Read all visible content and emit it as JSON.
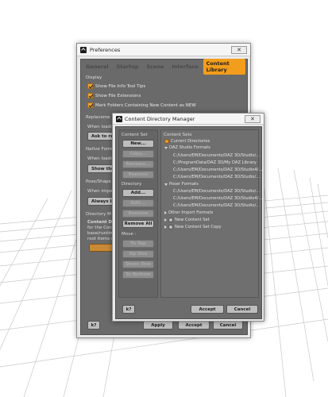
{
  "preferences": {
    "title": "Preferences",
    "close_label": "✕",
    "tabs": [
      "General",
      "Startup",
      "Scene",
      "Interface",
      "Content Library"
    ],
    "active_tab": "Content Library",
    "display_section": "Display",
    "checkboxes": [
      "Show File Info Tool Tips",
      "Show File Extensions",
      "Mark Folders Containing New Content as NEW"
    ],
    "replacement_section": "Replaceme",
    "when_loading_1": "When loadin",
    "ask_button": "Ask to re",
    "native_section": "Native Form",
    "when_loading_2": "When loadin",
    "show_button": "Show the",
    "pose_section": "Pose/Shape",
    "when_importing": "When impor",
    "always_button": "Always lo",
    "directory_section": "Directory M",
    "directory_text": [
      "Content Di",
      "for the Con",
      "base/runtim",
      "root items o"
    ],
    "help_button": "k?",
    "apply_button": "Apply",
    "accept_button": "Accept",
    "cancel_button": "Cancel"
  },
  "cdm": {
    "title": "Content Directory Manager",
    "close_label": "✕",
    "content_set_label": "Content Set",
    "new_button": "New...",
    "copy_button": "Copy...",
    "rename_button": "Rename...",
    "remove_button": "Remove",
    "directory_label": "Directory",
    "add_button": "Add...",
    "edit_button": "Edit...",
    "remove2_button": "Remove",
    "remove_all_button": "Remove All",
    "move_label": "Move :",
    "to_top_button": "To Top",
    "up_one_button": "Up One",
    "down_one_button": "Down One",
    "to_bottom_button": "To Bottom",
    "content_sets_label": "Content Sets",
    "tree": [
      "Current Directories",
      "DAZ Studio Formats",
      "C:/Users/EM/Documents/DAZ 3D/Studio/...",
      "C:/ProgramData/DAZ 3D/My DAZ Library",
      "C:/Users/EM/Documents/DAZ 3D/Studio4/...",
      "C:/Users/EM/Documents/DAZ 3D/Studio/...",
      "Poser Formats",
      "C:/Users/EM/Documents/DAZ 3D/Studio/...",
      "C:/Users/EM/Documents/DAZ 3D/Studio4/...",
      "C:/Users/EM/Documents/DAZ 3D/Studio/...",
      "Other Import Formats",
      "New Content Set",
      "New Content Set Copy"
    ],
    "help_button": "k?",
    "accept_button": "Accept",
    "cancel_button": "Cancel"
  },
  "colors": {
    "accent_orange": "#f39d1c",
    "panel_gray": "#6a6a6a"
  }
}
